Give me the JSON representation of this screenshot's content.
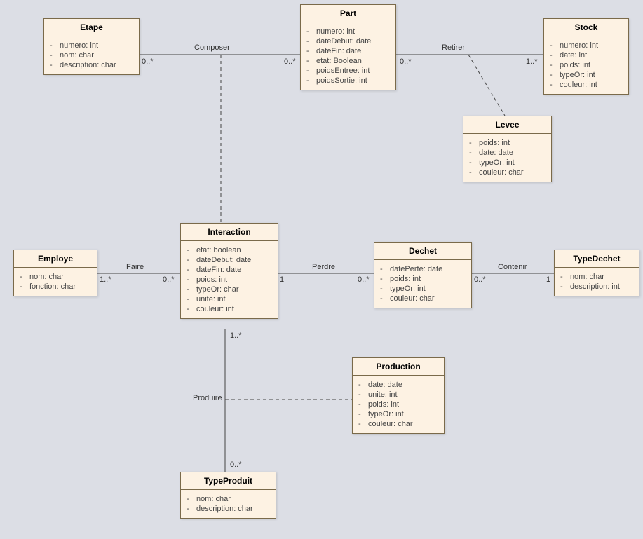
{
  "classes": {
    "etape": {
      "title": "Etape",
      "attrs": [
        "numero: int",
        "nom: char",
        "description: char"
      ]
    },
    "part": {
      "title": "Part",
      "attrs": [
        "numero: int",
        "dateDebut: date",
        "dateFin: date",
        "etat: Boolean",
        "poidsEntree: int",
        "poidsSortie: int"
      ]
    },
    "stock": {
      "title": "Stock",
      "attrs": [
        "numero: int",
        "date: int",
        "poids: int",
        "typeOr: int",
        "couleur: int"
      ]
    },
    "levee": {
      "title": "Levee",
      "attrs": [
        "poids: int",
        "date: date",
        "typeOr: int",
        "couleur: char"
      ]
    },
    "employe": {
      "title": "Employe",
      "attrs": [
        "nom: char",
        "fonction: char"
      ]
    },
    "interaction": {
      "title": "Interaction",
      "attrs": [
        "etat: boolean",
        "dateDebut: date",
        "dateFin: date",
        "poids: int",
        "typeOr: char",
        "unite: int",
        "couleur: int"
      ]
    },
    "dechet": {
      "title": "Dechet",
      "attrs": [
        "datePerte: date",
        "poids: int",
        "typeOr: int",
        "couleur: char"
      ]
    },
    "typedechet": {
      "title": "TypeDechet",
      "attrs": [
        "nom: char",
        "description: int"
      ]
    },
    "production": {
      "title": "Production",
      "attrs": [
        "date: date",
        "unite: int",
        "poids: int",
        "typeOr: int",
        "couleur: char"
      ]
    },
    "typeproduit": {
      "title": "TypeProduit",
      "attrs": [
        "nom: char",
        "description: char"
      ]
    }
  },
  "labels": {
    "composer": "Composer",
    "retirer": "Retirer",
    "faire": "Faire",
    "perdre": "Perdre",
    "contenir": "Contenir",
    "produire": "Produire"
  },
  "mults": {
    "m0s": "0..*",
    "m1": "1",
    "m1s": "1..*"
  }
}
